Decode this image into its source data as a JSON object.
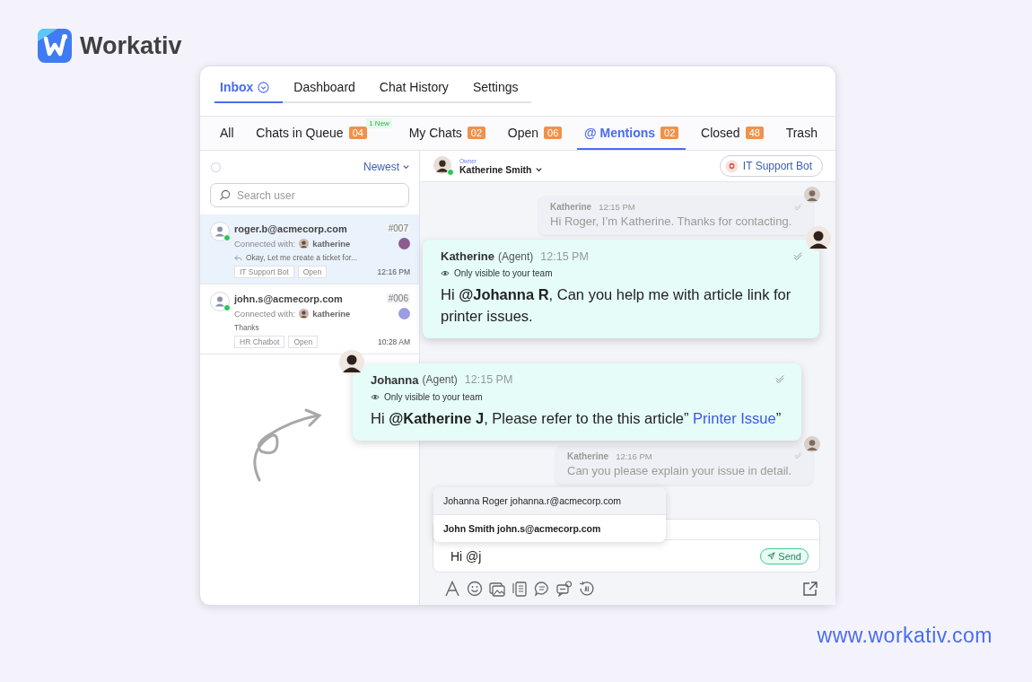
{
  "brand": {
    "name": "Workativ",
    "url": "www.workativ.com"
  },
  "nav_tabs": [
    {
      "label": "Inbox",
      "selected": true,
      "menu_icon": true
    },
    {
      "label": "Dashboard",
      "selected": false,
      "menu_icon": false
    },
    {
      "label": "Chat History",
      "selected": false,
      "menu_icon": false
    },
    {
      "label": "Settings",
      "selected": false,
      "menu_icon": false
    }
  ],
  "filter_tabs": [
    {
      "label": "All",
      "selected": false
    },
    {
      "label": "Chats in Queue",
      "count": "04",
      "new_badge": "1 New",
      "selected": false
    },
    {
      "label": "My Chats",
      "count": "02",
      "selected": false
    },
    {
      "label": "Open",
      "count": "06",
      "selected": false
    },
    {
      "label": "@ Mentions",
      "count": "02",
      "selected": true
    },
    {
      "label": "Closed",
      "count": "48",
      "selected": false
    },
    {
      "label": "Trash",
      "selected": false
    }
  ],
  "conversations": {
    "select_all_checked": false,
    "sort": "Newest",
    "search": {
      "placeholder": "Search user"
    },
    "items": [
      {
        "email": "roger.b@acmecorp.com",
        "number": "#007",
        "connected_label": "Connected with:",
        "agent": "katherine",
        "preview": "Okay, Let me create a ticket for...",
        "replied": true,
        "tags": [
          "IT Support Bot",
          "Open"
        ],
        "time": "12:16 PM",
        "online": true,
        "color": "#8b5c8e",
        "selected": true
      },
      {
        "email": "john.s@acmecorp.com",
        "number": "#006",
        "connected_label": "Connected with:",
        "agent": "katherine",
        "preview": "Thanks",
        "replied": false,
        "tags": [
          "HR Chatbot",
          "Open"
        ],
        "time": "10:28 AM",
        "online": true,
        "color": "#9a9de0",
        "selected": false
      }
    ]
  },
  "chat": {
    "owner_label": "Owner",
    "owner": "Katherine Smith",
    "owner_online": true,
    "bot": "IT Support Bot",
    "messages": [
      {
        "kind": "plain",
        "sender": "Katherine",
        "time": "12:15 PM",
        "text": "Hi Roger, I’m Katherine. Thanks for contacting."
      },
      {
        "kind": "internal",
        "sender": "Katherine",
        "role": "(Agent)",
        "time": "12:15 PM",
        "visibility": "Only visible to your team",
        "text": "Hi **@Johanna R**, Can you help me with article link for printer issues."
      },
      {
        "kind": "internal",
        "sender": "Johanna",
        "role": "(Agent)",
        "time": "12:15 PM",
        "visibility": "Only visible to your team",
        "text": "Hi **@Katherine J**, Please refer to the this article” ",
        "link": "Printer Issue",
        "text_after": "”"
      },
      {
        "kind": "plain",
        "sender": "Katherine",
        "time": "12:16 PM",
        "text": "Can you please explain your issue in detail."
      }
    ],
    "mention_suggestions": [
      {
        "label": "Johanna Roger johanna.r@acmecorp.com",
        "selected": true
      },
      {
        "label": "John Smith john.s@acmecorp.com",
        "selected": false
      }
    ],
    "composer": {
      "value": "Hi @j",
      "send": "Send"
    }
  }
}
